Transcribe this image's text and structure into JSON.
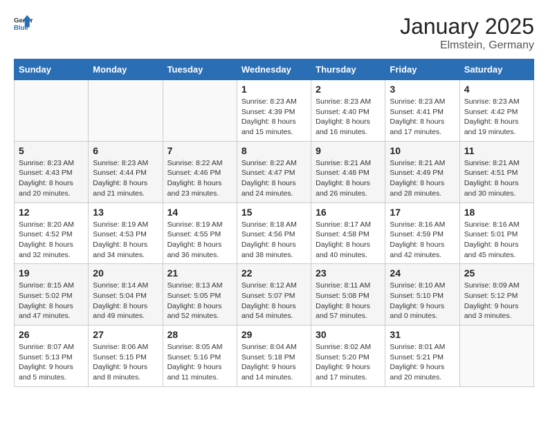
{
  "header": {
    "logo_general": "General",
    "logo_blue": "Blue",
    "title": "January 2025",
    "location": "Elmstein, Germany"
  },
  "weekdays": [
    "Sunday",
    "Monday",
    "Tuesday",
    "Wednesday",
    "Thursday",
    "Friday",
    "Saturday"
  ],
  "weeks": [
    [
      {
        "day": "",
        "sunrise": "",
        "sunset": "",
        "daylight": ""
      },
      {
        "day": "",
        "sunrise": "",
        "sunset": "",
        "daylight": ""
      },
      {
        "day": "",
        "sunrise": "",
        "sunset": "",
        "daylight": ""
      },
      {
        "day": "1",
        "sunrise": "Sunrise: 8:23 AM",
        "sunset": "Sunset: 4:39 PM",
        "daylight": "Daylight: 8 hours and 15 minutes."
      },
      {
        "day": "2",
        "sunrise": "Sunrise: 8:23 AM",
        "sunset": "Sunset: 4:40 PM",
        "daylight": "Daylight: 8 hours and 16 minutes."
      },
      {
        "day": "3",
        "sunrise": "Sunrise: 8:23 AM",
        "sunset": "Sunset: 4:41 PM",
        "daylight": "Daylight: 8 hours and 17 minutes."
      },
      {
        "day": "4",
        "sunrise": "Sunrise: 8:23 AM",
        "sunset": "Sunset: 4:42 PM",
        "daylight": "Daylight: 8 hours and 19 minutes."
      }
    ],
    [
      {
        "day": "5",
        "sunrise": "Sunrise: 8:23 AM",
        "sunset": "Sunset: 4:43 PM",
        "daylight": "Daylight: 8 hours and 20 minutes."
      },
      {
        "day": "6",
        "sunrise": "Sunrise: 8:23 AM",
        "sunset": "Sunset: 4:44 PM",
        "daylight": "Daylight: 8 hours and 21 minutes."
      },
      {
        "day": "7",
        "sunrise": "Sunrise: 8:22 AM",
        "sunset": "Sunset: 4:46 PM",
        "daylight": "Daylight: 8 hours and 23 minutes."
      },
      {
        "day": "8",
        "sunrise": "Sunrise: 8:22 AM",
        "sunset": "Sunset: 4:47 PM",
        "daylight": "Daylight: 8 hours and 24 minutes."
      },
      {
        "day": "9",
        "sunrise": "Sunrise: 8:21 AM",
        "sunset": "Sunset: 4:48 PM",
        "daylight": "Daylight: 8 hours and 26 minutes."
      },
      {
        "day": "10",
        "sunrise": "Sunrise: 8:21 AM",
        "sunset": "Sunset: 4:49 PM",
        "daylight": "Daylight: 8 hours and 28 minutes."
      },
      {
        "day": "11",
        "sunrise": "Sunrise: 8:21 AM",
        "sunset": "Sunset: 4:51 PM",
        "daylight": "Daylight: 8 hours and 30 minutes."
      }
    ],
    [
      {
        "day": "12",
        "sunrise": "Sunrise: 8:20 AM",
        "sunset": "Sunset: 4:52 PM",
        "daylight": "Daylight: 8 hours and 32 minutes."
      },
      {
        "day": "13",
        "sunrise": "Sunrise: 8:19 AM",
        "sunset": "Sunset: 4:53 PM",
        "daylight": "Daylight: 8 hours and 34 minutes."
      },
      {
        "day": "14",
        "sunrise": "Sunrise: 8:19 AM",
        "sunset": "Sunset: 4:55 PM",
        "daylight": "Daylight: 8 hours and 36 minutes."
      },
      {
        "day": "15",
        "sunrise": "Sunrise: 8:18 AM",
        "sunset": "Sunset: 4:56 PM",
        "daylight": "Daylight: 8 hours and 38 minutes."
      },
      {
        "day": "16",
        "sunrise": "Sunrise: 8:17 AM",
        "sunset": "Sunset: 4:58 PM",
        "daylight": "Daylight: 8 hours and 40 minutes."
      },
      {
        "day": "17",
        "sunrise": "Sunrise: 8:16 AM",
        "sunset": "Sunset: 4:59 PM",
        "daylight": "Daylight: 8 hours and 42 minutes."
      },
      {
        "day": "18",
        "sunrise": "Sunrise: 8:16 AM",
        "sunset": "Sunset: 5:01 PM",
        "daylight": "Daylight: 8 hours and 45 minutes."
      }
    ],
    [
      {
        "day": "19",
        "sunrise": "Sunrise: 8:15 AM",
        "sunset": "Sunset: 5:02 PM",
        "daylight": "Daylight: 8 hours and 47 minutes."
      },
      {
        "day": "20",
        "sunrise": "Sunrise: 8:14 AM",
        "sunset": "Sunset: 5:04 PM",
        "daylight": "Daylight: 8 hours and 49 minutes."
      },
      {
        "day": "21",
        "sunrise": "Sunrise: 8:13 AM",
        "sunset": "Sunset: 5:05 PM",
        "daylight": "Daylight: 8 hours and 52 minutes."
      },
      {
        "day": "22",
        "sunrise": "Sunrise: 8:12 AM",
        "sunset": "Sunset: 5:07 PM",
        "daylight": "Daylight: 8 hours and 54 minutes."
      },
      {
        "day": "23",
        "sunrise": "Sunrise: 8:11 AM",
        "sunset": "Sunset: 5:08 PM",
        "daylight": "Daylight: 8 hours and 57 minutes."
      },
      {
        "day": "24",
        "sunrise": "Sunrise: 8:10 AM",
        "sunset": "Sunset: 5:10 PM",
        "daylight": "Daylight: 9 hours and 0 minutes."
      },
      {
        "day": "25",
        "sunrise": "Sunrise: 8:09 AM",
        "sunset": "Sunset: 5:12 PM",
        "daylight": "Daylight: 9 hours and 3 minutes."
      }
    ],
    [
      {
        "day": "26",
        "sunrise": "Sunrise: 8:07 AM",
        "sunset": "Sunset: 5:13 PM",
        "daylight": "Daylight: 9 hours and 5 minutes."
      },
      {
        "day": "27",
        "sunrise": "Sunrise: 8:06 AM",
        "sunset": "Sunset: 5:15 PM",
        "daylight": "Daylight: 9 hours and 8 minutes."
      },
      {
        "day": "28",
        "sunrise": "Sunrise: 8:05 AM",
        "sunset": "Sunset: 5:16 PM",
        "daylight": "Daylight: 9 hours and 11 minutes."
      },
      {
        "day": "29",
        "sunrise": "Sunrise: 8:04 AM",
        "sunset": "Sunset: 5:18 PM",
        "daylight": "Daylight: 9 hours and 14 minutes."
      },
      {
        "day": "30",
        "sunrise": "Sunrise: 8:02 AM",
        "sunset": "Sunset: 5:20 PM",
        "daylight": "Daylight: 9 hours and 17 minutes."
      },
      {
        "day": "31",
        "sunrise": "Sunrise: 8:01 AM",
        "sunset": "Sunset: 5:21 PM",
        "daylight": "Daylight: 9 hours and 20 minutes."
      },
      {
        "day": "",
        "sunrise": "",
        "sunset": "",
        "daylight": ""
      }
    ]
  ]
}
